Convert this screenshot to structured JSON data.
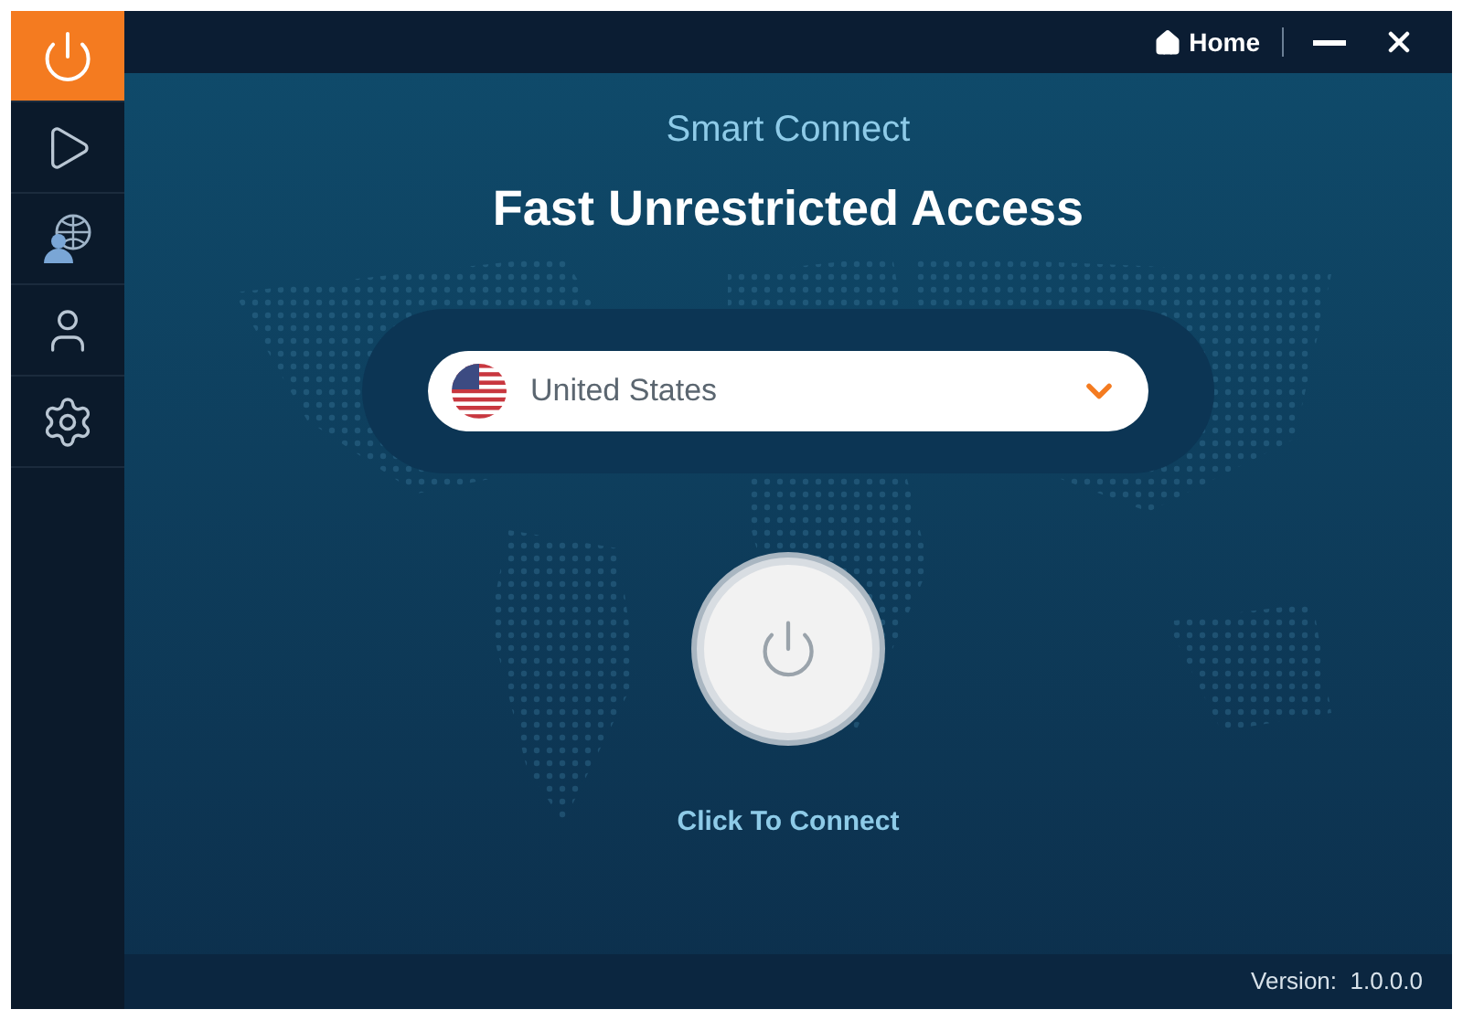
{
  "sidebar": {
    "items": [
      {
        "kind": "power",
        "selected": true
      },
      {
        "kind": "play",
        "selected": false
      },
      {
        "kind": "globe-users",
        "selected": false
      },
      {
        "kind": "user",
        "selected": false
      },
      {
        "kind": "settings",
        "selected": false
      }
    ]
  },
  "title_bar": {
    "home_link": "Home"
  },
  "subtitle": "Smart Connect",
  "headline": "Fast Unrestricted Access",
  "country_select": {
    "value": "United States"
  },
  "connect_label": "Click To Connect",
  "status_bar": {
    "version": "Version:  1.0.0.0"
  }
}
